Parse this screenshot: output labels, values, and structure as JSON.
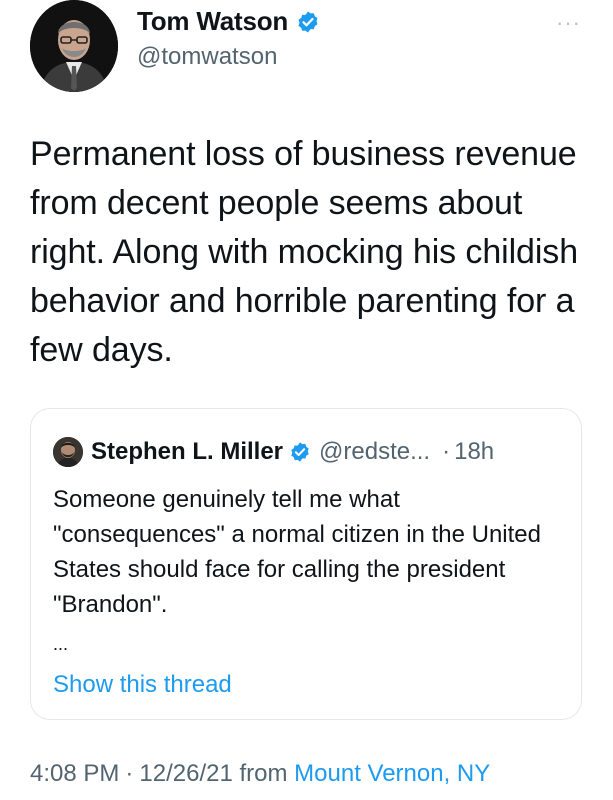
{
  "tweet": {
    "author_name": "Tom Watson",
    "author_handle": "@tomwatson",
    "more_label": "···",
    "text": "Permanent loss of business revenue from decent people seems about right. Along with mocking his childish behavior and horrible parenting for a few days.",
    "time": "4:08 PM",
    "separator": "·",
    "date": "12/26/21",
    "from_label": "from",
    "location": "Mount Vernon, NY"
  },
  "quote": {
    "author_name": "Stephen L. Miller",
    "author_handle": "@redste...",
    "separator": "·",
    "time": "18h",
    "text": "Someone genuinely tell me what \"consequences\" a normal citizen in the United States should face for calling the president \"Brandon\".",
    "ellipsis": "...",
    "show_thread": "Show this thread"
  },
  "icons": {
    "avatar": "person-photo",
    "verified": "verified-badge-icon",
    "more": "more-options-icon"
  },
  "colors": {
    "link": "#1d9bf0",
    "secondary_text": "#536471",
    "primary_text": "#0f1419",
    "border": "#e4e8eb"
  }
}
